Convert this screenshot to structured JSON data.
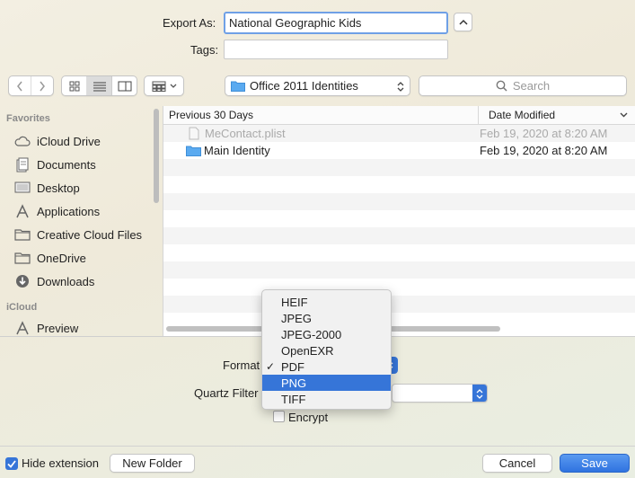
{
  "top": {
    "export_label": "Export As:",
    "export_value": "National Geographic Kids",
    "tags_label": "Tags:",
    "tags_value": ""
  },
  "toolbar": {
    "location": "Office 2011 Identities",
    "search_placeholder": "Search"
  },
  "sidebar": {
    "favorites_header": "Favorites",
    "items": [
      {
        "label": "iCloud Drive",
        "icon": "cloud-icon"
      },
      {
        "label": "Documents",
        "icon": "document-icon"
      },
      {
        "label": "Desktop",
        "icon": "desktop-icon"
      },
      {
        "label": "Applications",
        "icon": "applications-icon"
      },
      {
        "label": "Creative Cloud Files",
        "icon": "folder-icon"
      },
      {
        "label": "OneDrive",
        "icon": "folder-icon"
      },
      {
        "label": "Downloads",
        "icon": "download-icon"
      }
    ],
    "icloud_header": "iCloud",
    "icloud_items": [
      {
        "label": "Preview",
        "icon": "applications-icon"
      }
    ]
  },
  "files": {
    "col_name": "Previous 30 Days",
    "col_date": "Date Modified",
    "rows": [
      {
        "name": "MeContact.plist",
        "date": "Feb 19, 2020 at 8:20 AM",
        "disabled": true,
        "icon": "file-icon"
      },
      {
        "name": "Main Identity",
        "date": "Feb 19, 2020 at 8:20 AM",
        "disabled": false,
        "icon": "folder-icon"
      }
    ]
  },
  "options": {
    "format_label": "Format",
    "quartz_label": "Quartz Filter",
    "encrypt_label": "Encrypt"
  },
  "format_menu": {
    "items": [
      "HEIF",
      "JPEG",
      "JPEG-2000",
      "OpenEXR",
      "PDF",
      "PNG",
      "TIFF"
    ],
    "checked": "PDF",
    "highlighted": "PNG"
  },
  "bottom": {
    "hide_extension_label": "Hide extension",
    "new_folder_label": "New Folder",
    "cancel_label": "Cancel",
    "save_label": "Save"
  },
  "colors": {
    "accent": "#3675d8",
    "folder": "#5aaaf0"
  }
}
